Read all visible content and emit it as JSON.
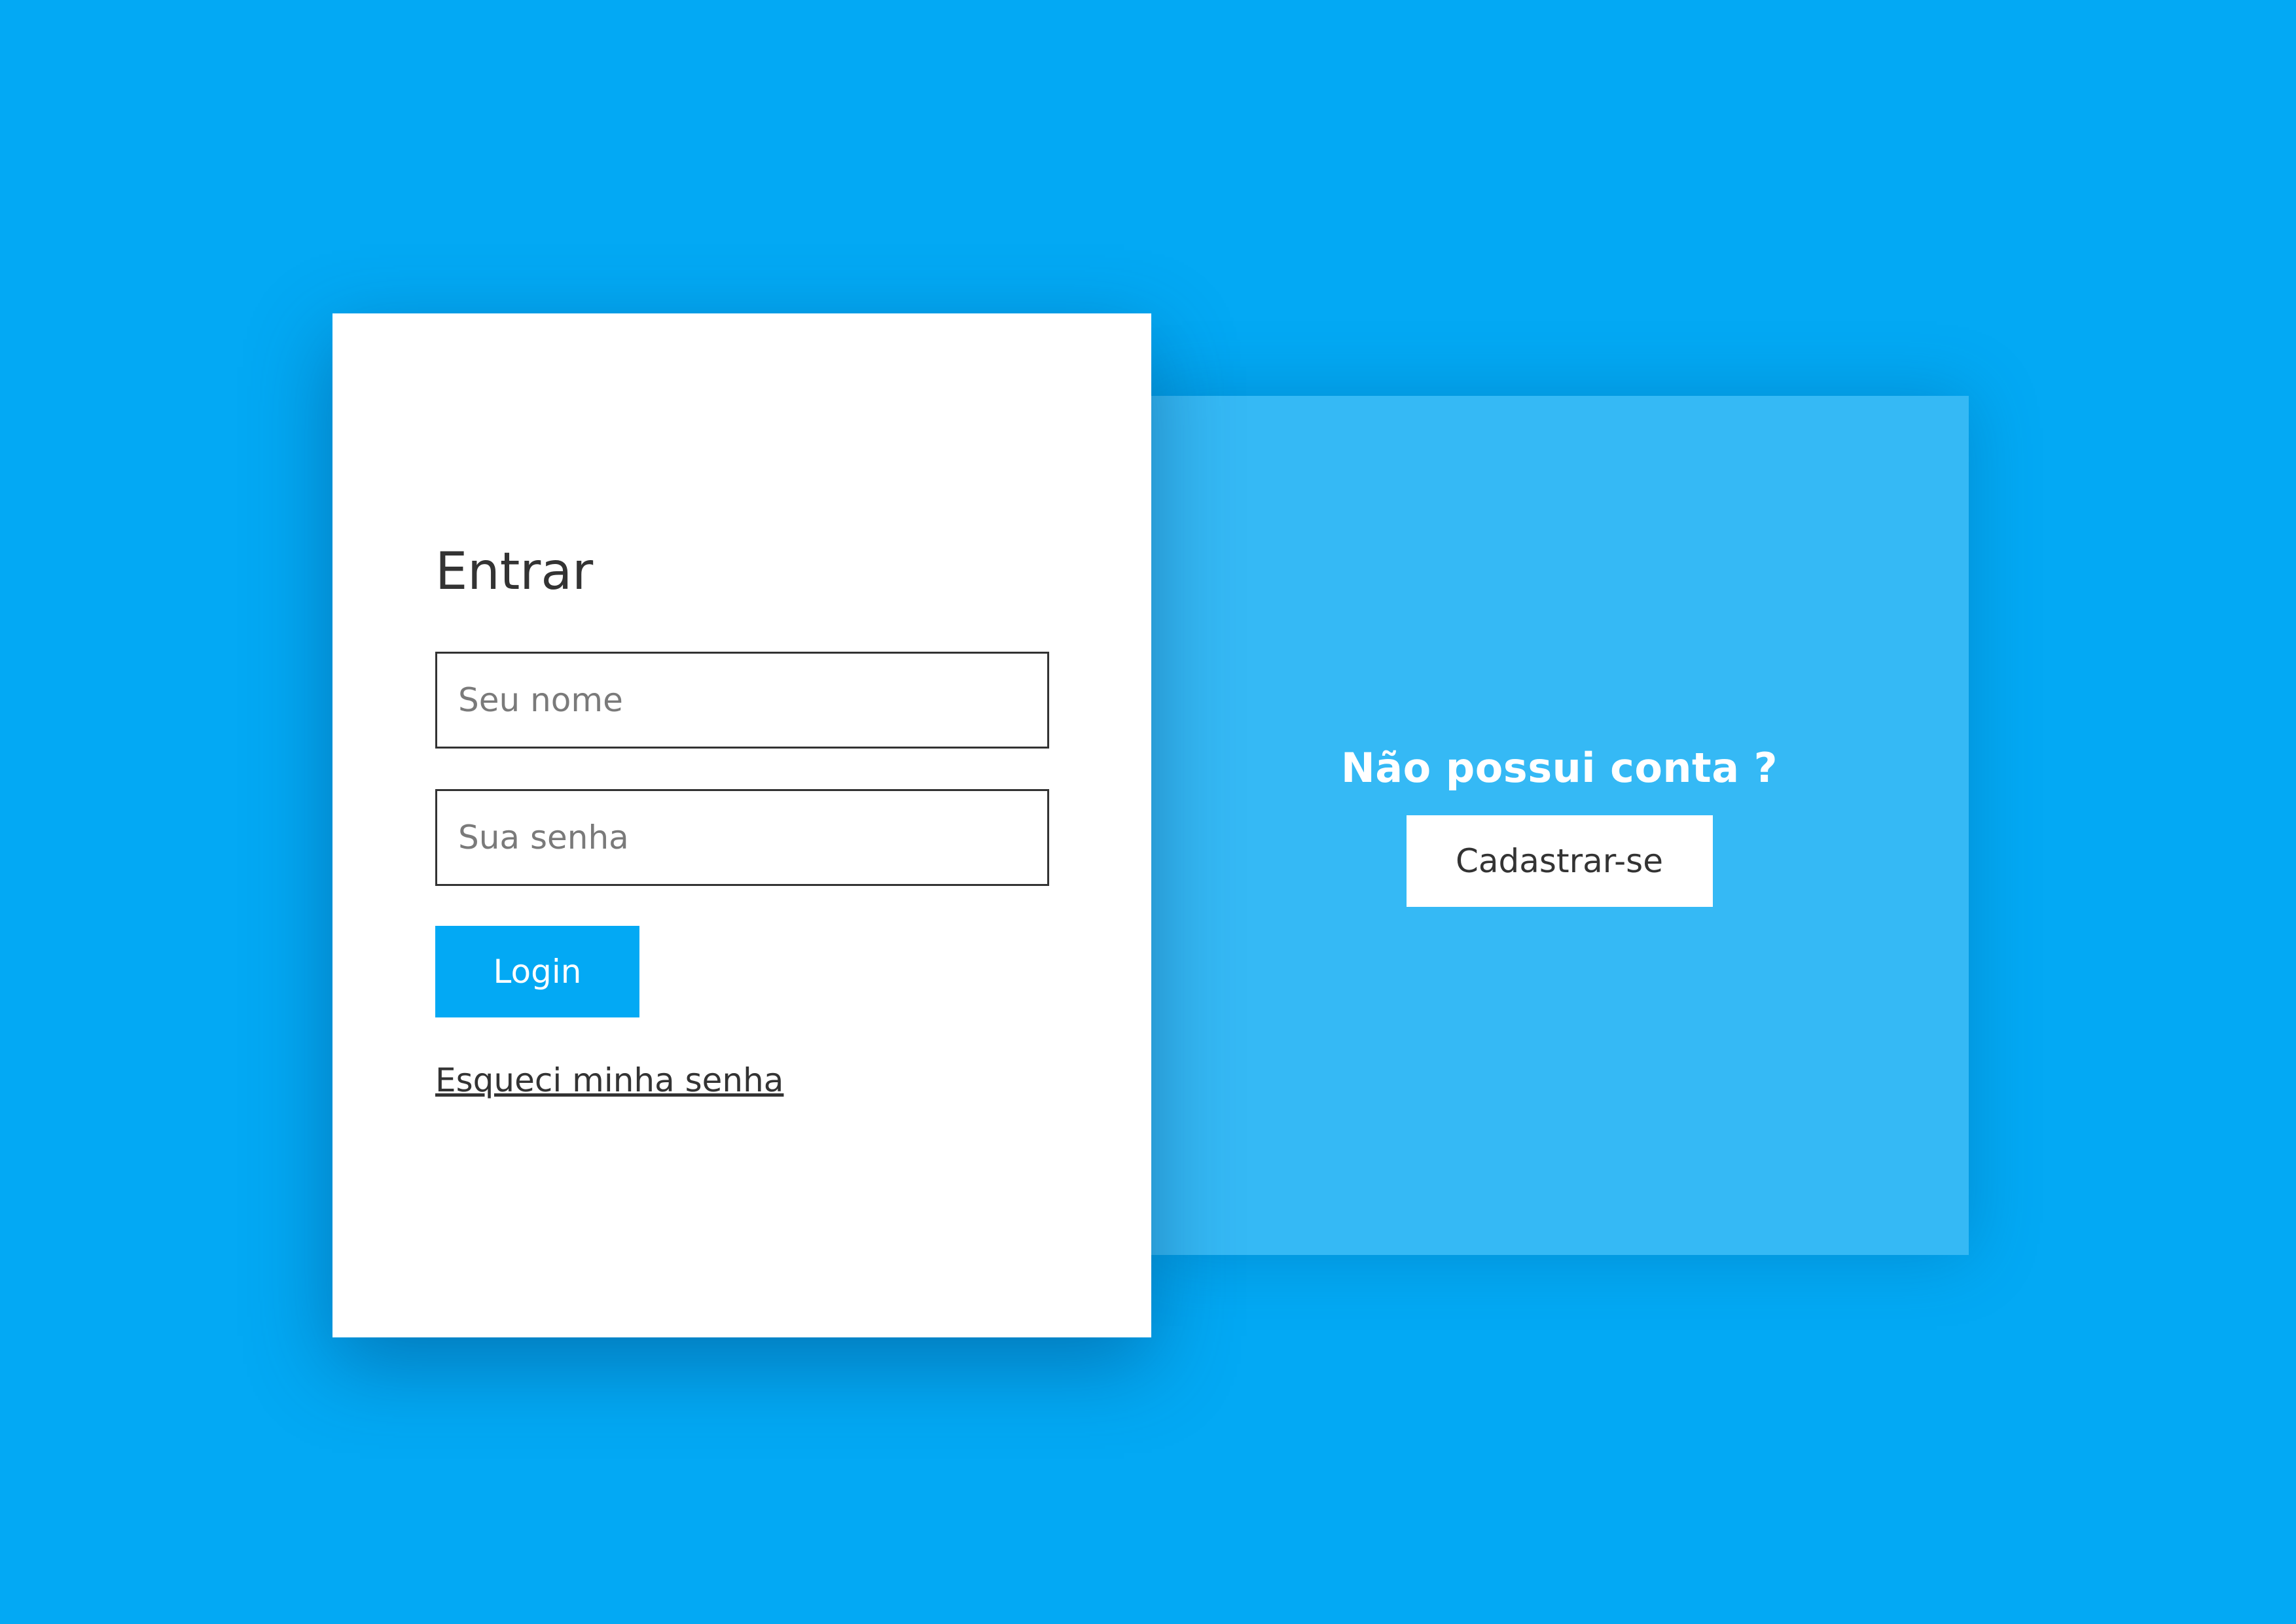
{
  "colors": {
    "background": "#03a9f4",
    "register_panel": "#35b9f5",
    "login_panel": "#ffffff",
    "accent": "#03a9f4",
    "text_dark": "#333333"
  },
  "login": {
    "title": "Entrar",
    "name_input": {
      "value": "",
      "placeholder": "Seu nome"
    },
    "password_input": {
      "value": "",
      "placeholder": "Sua senha"
    },
    "login_button_label": "Login",
    "forgot_password_link": "Esqueci minha senha"
  },
  "register": {
    "title": "Não possui conta ?",
    "button_label": "Cadastrar-se"
  }
}
